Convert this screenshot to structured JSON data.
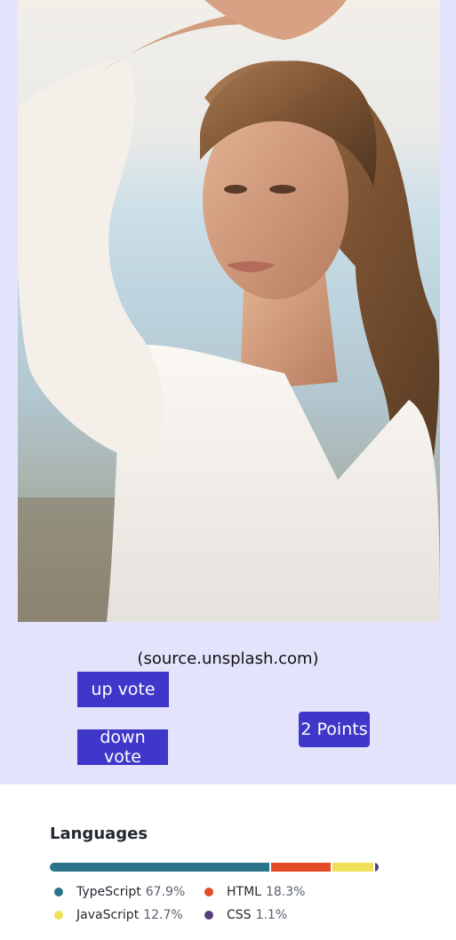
{
  "card": {
    "source_text": "(source.unsplash.com)",
    "up_vote_label": "up vote",
    "down_vote_label": "down vote",
    "points_label": "2 Points"
  },
  "languages": {
    "title": "Languages",
    "items": [
      {
        "name": "TypeScript",
        "percent": "67.9%",
        "value": 67.9,
        "color": "#2b7489"
      },
      {
        "name": "HTML",
        "percent": "18.3%",
        "value": 18.3,
        "color": "#e34c26"
      },
      {
        "name": "JavaScript",
        "percent": "12.7%",
        "value": 12.7,
        "color": "#f1e05a"
      },
      {
        "name": "CSS",
        "percent": "1.1%",
        "value": 1.1,
        "color": "#563d7c"
      }
    ]
  }
}
